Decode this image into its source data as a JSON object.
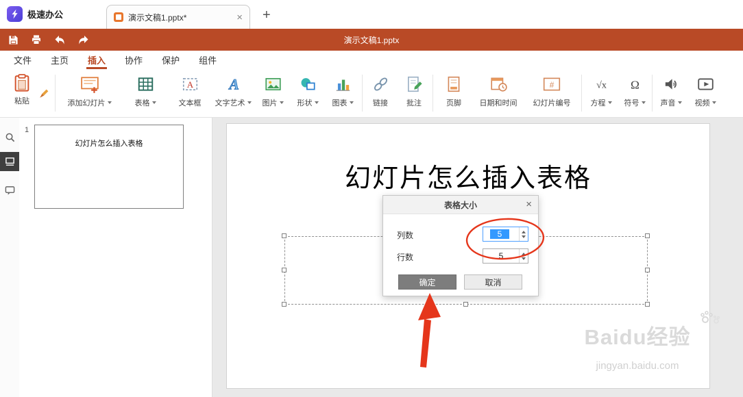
{
  "colors": {
    "accent_red": "#b94a26",
    "annotation_red": "#e5361b",
    "selection_blue": "#3399ff",
    "ok_button_gray": "#7d7d7d"
  },
  "tabbar": {
    "app_name": "极速办公",
    "tab": {
      "title": "演示文稿1.pptx*",
      "close_glyph": "×"
    },
    "new_tab_glyph": "+"
  },
  "titlebar": {
    "document_title": "演示文稿1.pptx"
  },
  "menubar": {
    "items": [
      {
        "label": "文件"
      },
      {
        "label": "主页"
      },
      {
        "label": "插入",
        "active": true
      },
      {
        "label": "协作"
      },
      {
        "label": "保护"
      },
      {
        "label": "组件"
      }
    ]
  },
  "ribbon": {
    "paste": {
      "label": "粘贴"
    },
    "items": [
      {
        "name": "add-slide",
        "label": "添加幻灯片",
        "dropdown": true
      },
      {
        "name": "table",
        "label": "表格",
        "dropdown": true
      },
      {
        "name": "textbox",
        "label": "文本框",
        "dropdown": false
      },
      {
        "name": "wordart",
        "label": "文字艺术",
        "dropdown": true
      },
      {
        "name": "picture",
        "label": "图片",
        "dropdown": true
      },
      {
        "name": "shapes",
        "label": "形状",
        "dropdown": true
      },
      {
        "name": "chart",
        "label": "图表",
        "dropdown": true
      },
      {
        "name": "link",
        "label": "链接",
        "dropdown": false
      },
      {
        "name": "comment",
        "label": "批注",
        "dropdown": false
      },
      {
        "name": "footer",
        "label": "页脚",
        "dropdown": false
      },
      {
        "name": "datetime",
        "label": "日期和时间",
        "dropdown": false
      },
      {
        "name": "slide-number",
        "label": "幻灯片编号",
        "dropdown": false
      },
      {
        "name": "equation",
        "label": "方程",
        "dropdown": true
      },
      {
        "name": "symbol",
        "label": "符号",
        "dropdown": true
      },
      {
        "name": "sound",
        "label": "声音",
        "dropdown": true
      },
      {
        "name": "video",
        "label": "视频",
        "dropdown": true
      }
    ]
  },
  "thumbnail_panel": {
    "slide_number": "1"
  },
  "slide": {
    "title": "幻灯片怎么插入表格"
  },
  "dialog": {
    "title": "表格大小",
    "close_glyph": "×",
    "fields": [
      {
        "label": "列数",
        "value": "5",
        "selected": true
      },
      {
        "label": "行数",
        "value": "5",
        "selected": false
      }
    ],
    "buttons": {
      "ok": "确定",
      "cancel": "取消"
    }
  },
  "watermark": {
    "brand": "Baidu经验",
    "url": "jingyan.baidu.com"
  },
  "icons": {
    "app-logo": "lightning-bolt",
    "save": "floppy-disk",
    "print": "printer",
    "undo": "curved-arrow-left",
    "redo": "curved-arrow-right",
    "chevron-down": "▾",
    "close": "×",
    "search": "magnifier",
    "slides-panel": "film-strip",
    "comments-panel": "speech-bubble",
    "spinner-up": "▲",
    "spinner-down": "▼"
  }
}
